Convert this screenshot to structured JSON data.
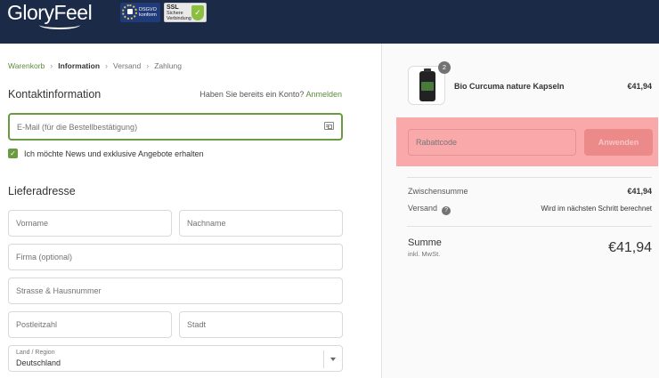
{
  "header": {
    "brand": "GloryFeel",
    "badges": [
      {
        "line1": "DSGVO",
        "line2": "konform"
      },
      {
        "line1": "SSL",
        "line2": "Sichere",
        "line3": "Verbindung"
      }
    ]
  },
  "breadcrumb": {
    "items": [
      "Warenkorb",
      "Information",
      "Versand",
      "Zahlung"
    ]
  },
  "contact": {
    "heading": "Kontaktinformation",
    "account_prompt": "Haben Sie bereits ein Konto?",
    "login_link": "Anmelden",
    "email_placeholder": "E-Mail (für die Bestellbestätigung)",
    "newsletter_label": "Ich möchte News und exklusive Angebote erhalten"
  },
  "shipping": {
    "heading": "Lieferadresse",
    "first_name_placeholder": "Vorname",
    "last_name_placeholder": "Nachname",
    "company_placeholder": "Firma (optional)",
    "street_placeholder": "Strasse & Hausnummer",
    "zip_placeholder": "Postleitzahl",
    "city_placeholder": "Stadt",
    "country_label": "Land / Region",
    "country_value": "Deutschland"
  },
  "summary": {
    "product": {
      "name": "Bio Curcuma nature Kapseln",
      "quantity": "2",
      "price": "€41,94"
    },
    "coupon": {
      "placeholder": "Rabattcode",
      "button": "Anwenden"
    },
    "subtotal_label": "Zwischensumme",
    "subtotal_value": "€41,94",
    "shipping_label": "Versand",
    "shipping_help": "?",
    "shipping_value": "Wird im nächsten Schritt berechnet",
    "total_label": "Summe",
    "total_sub": "inkl. MwSt.",
    "total_value": "€41,94"
  },
  "colors": {
    "header_bg": "#1b2a47",
    "accent_green": "#6a9b3e",
    "highlight_red": "#f9a9a9"
  }
}
